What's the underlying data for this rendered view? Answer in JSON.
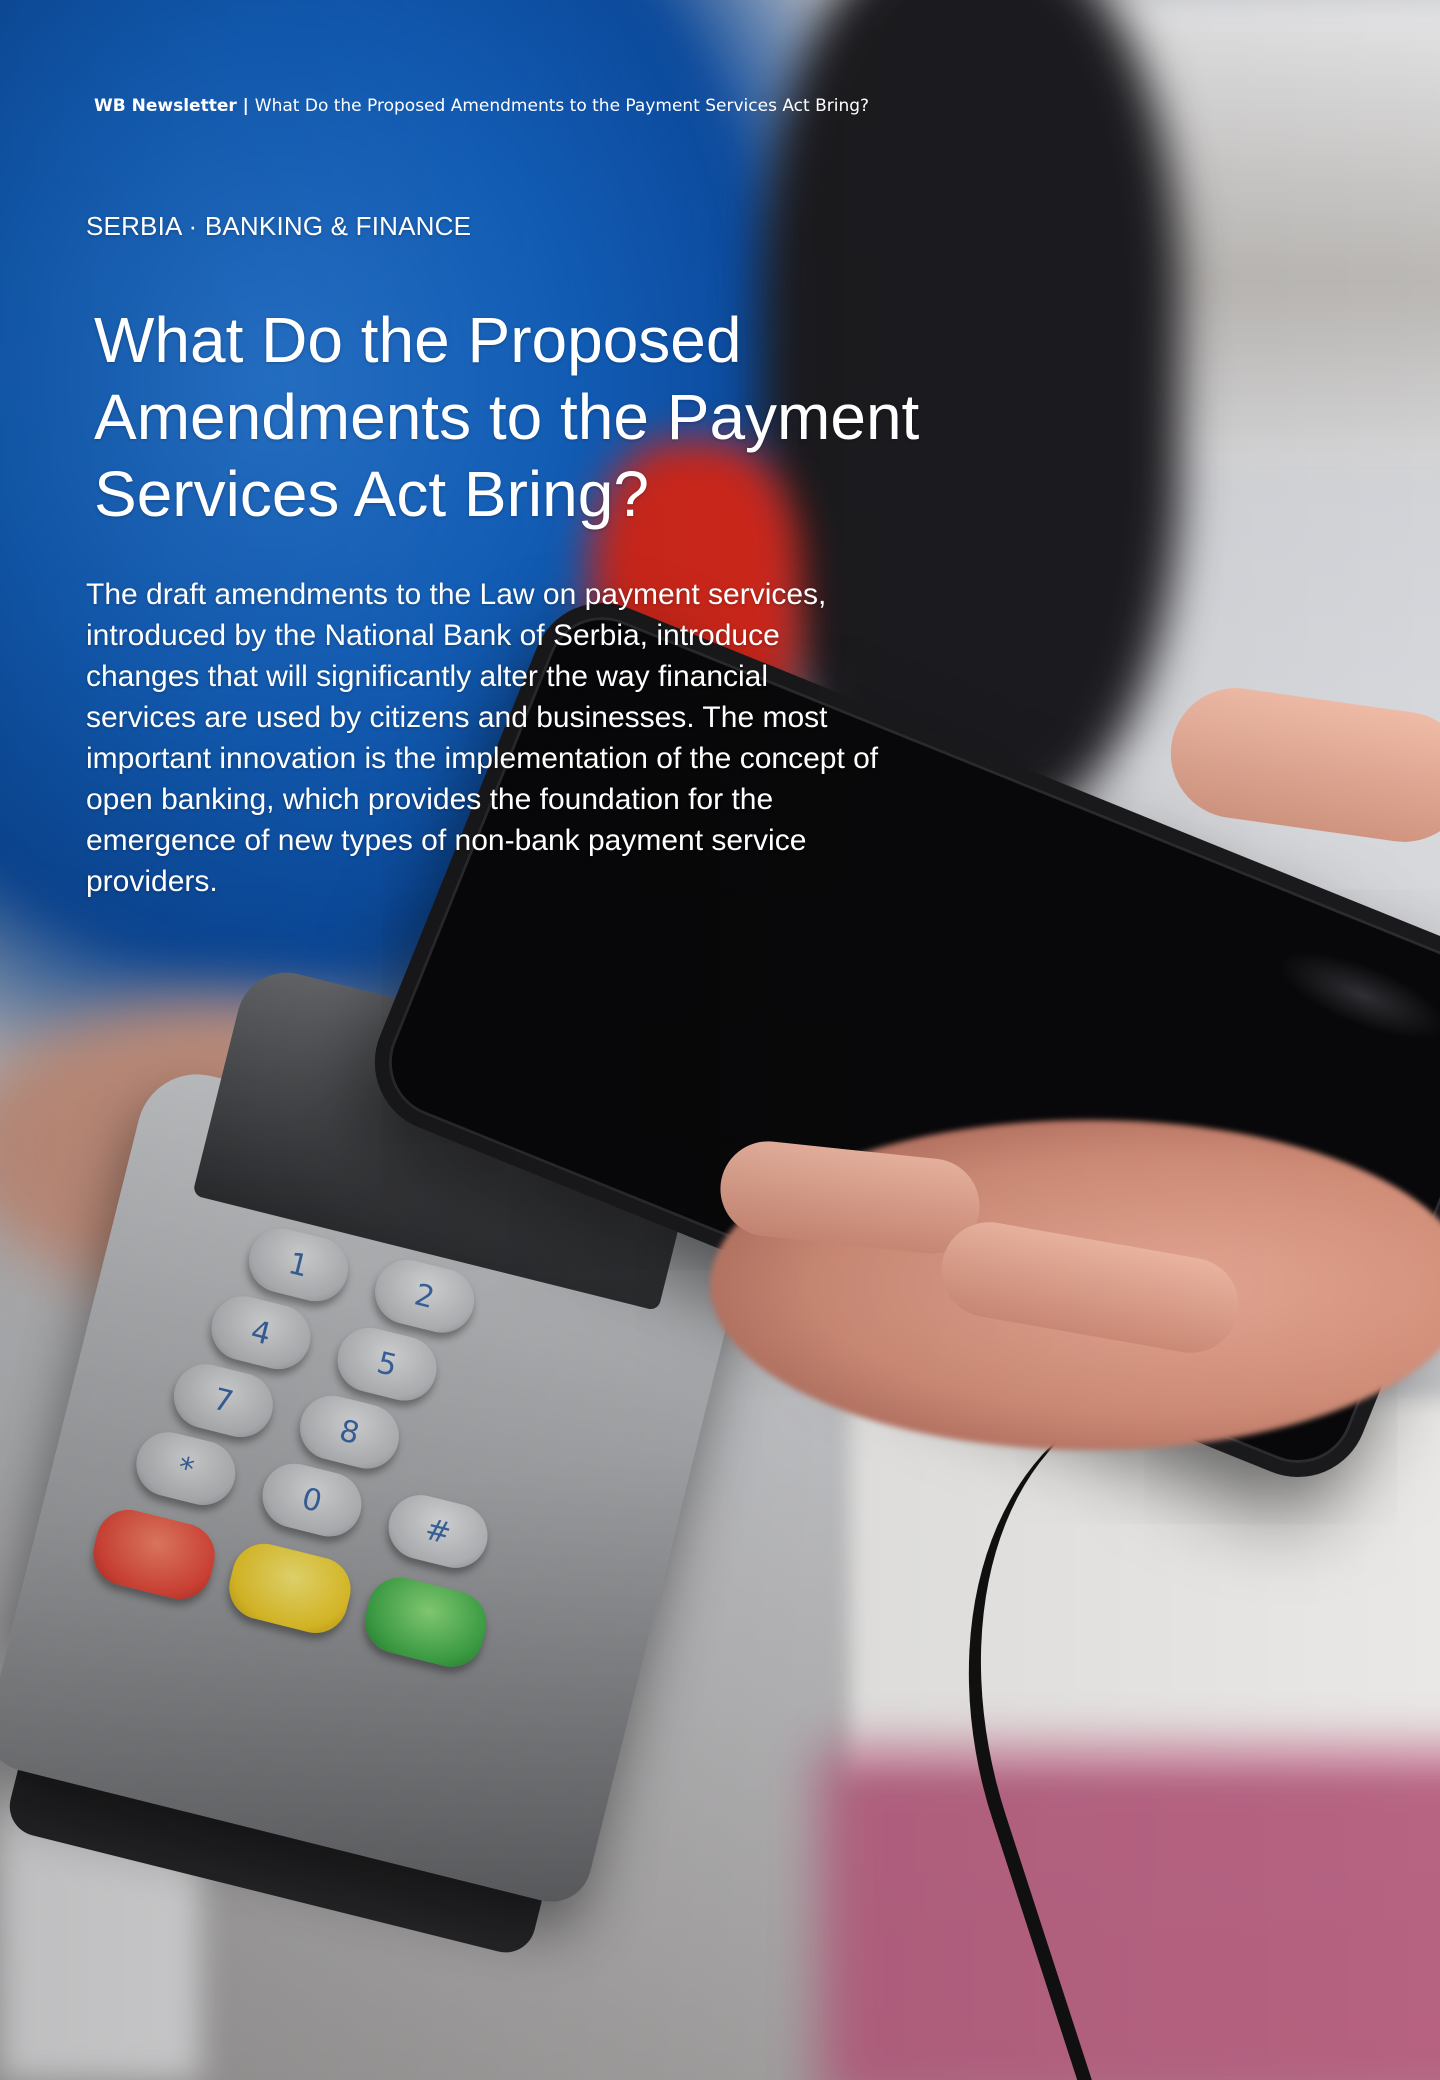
{
  "header": {
    "brand": "WB Newsletter",
    "separator": " | ",
    "article_title": "What Do the Proposed Amendments to the Payment Services Act Bring?"
  },
  "category": "SERBIA · BANKING & FINANCE",
  "title": "What Do the Proposed Amendments to the Payment Services Act Bring?",
  "lead": "The draft amendments to the Law on payment services, introduced by the National Bank of Serbia, introduce changes that will significantly alter the way financial services are used by citizens and businesses. The most important innovation is the implementation of the concept of open banking, which provides the foundation for the emergence of new types of non-bank payment service providers.",
  "colors": {
    "text": "#ffffff",
    "jacket_blue": "#1466c8",
    "accent_red": "#d8291c"
  }
}
